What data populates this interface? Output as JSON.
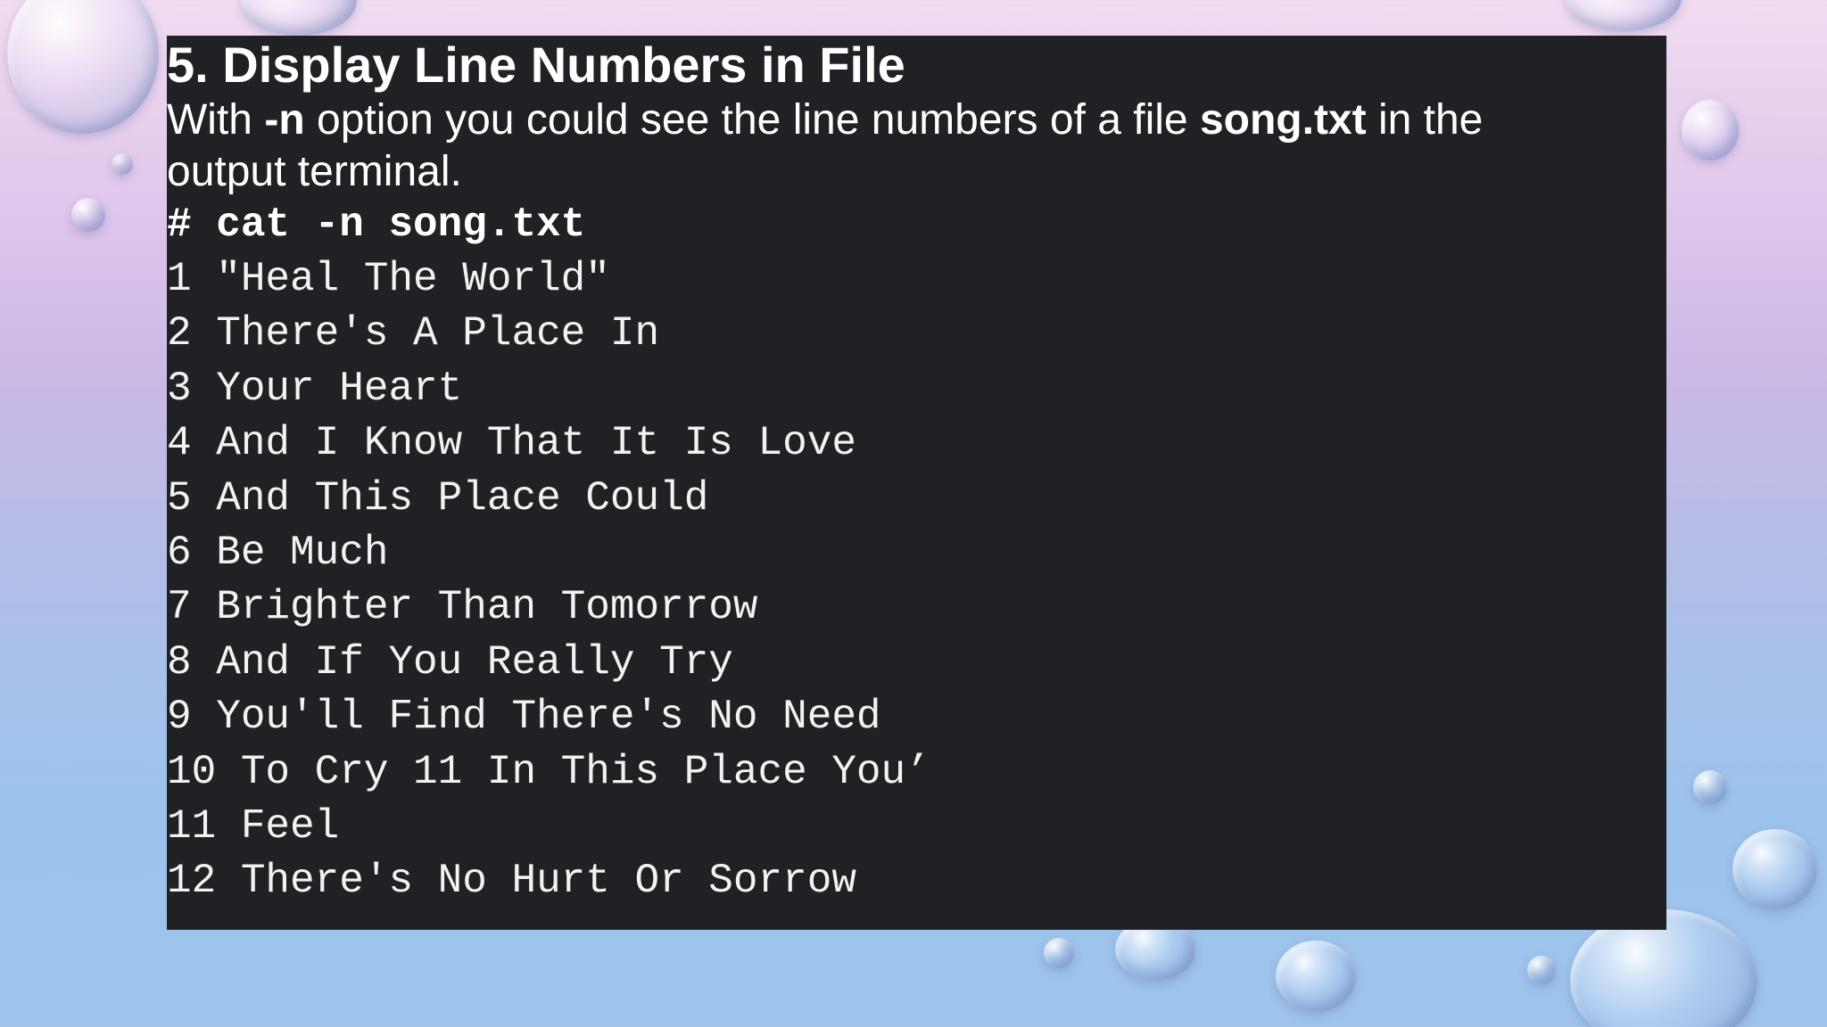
{
  "slide": {
    "title": "5. Display Line Numbers in File",
    "description": {
      "part1": "With ",
      "option": "-n",
      "part2": " option you could see the line numbers of a file ",
      "filename": "song.txt",
      "part3": " in the output terminal."
    },
    "command": "# cat -n song.txt",
    "output_lines": [
      "1 \"Heal The World\"",
      "2 There's A Place In",
      "3 Your Heart",
      "4 And I Know That It Is Love",
      "5 And This Place Could",
      "6 Be Much",
      "7 Brighter Than Tomorrow",
      "8 And If You Really Try",
      "9 You'll Find There's No Need",
      "10 To Cry 11 In This Place You’",
      "11 Feel",
      "12 There's No Hurt Or Sorrow"
    ]
  },
  "colors": {
    "panel_background": "#1f2125",
    "text": "#ffffff",
    "page_gradient_top": "#f1dcf0",
    "page_gradient_bottom": "#9ec4ec"
  }
}
